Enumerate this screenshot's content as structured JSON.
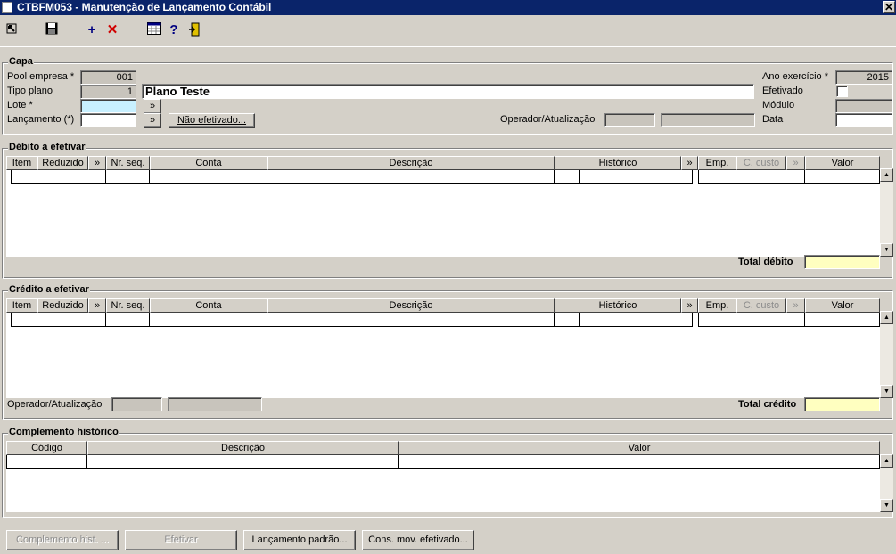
{
  "window": {
    "title": "CTBFM053 - Manutenção de Lançamento Contábil",
    "close_label": "✕"
  },
  "toolbar": {
    "exit_icon": "↖",
    "save_icon": "save-icon",
    "add": "+",
    "delete": "✕",
    "calendar_icon": "calendar-icon",
    "help": "?",
    "door_icon": "door-icon"
  },
  "capa": {
    "title": "Capa",
    "pool_label": "Pool empresa *",
    "pool_value": "001",
    "tipo_label": "Tipo plano",
    "tipo_value": "1",
    "plano_name": "Plano Teste",
    "lote_label": "Lote *",
    "lote_value": "",
    "lanc_label": "Lançamento (*)",
    "lanc_value": "",
    "lookup": "»",
    "nao_efetivado": "Não efetivado...",
    "ano_label": "Ano exercício *",
    "ano_value": "2015",
    "efetivado_label": "Efetivado",
    "modulo_label": "Módulo",
    "modulo_value": "",
    "data_label": "Data",
    "data_value": "",
    "operador_label": "Operador/Atualização"
  },
  "grid_columns": [
    "Item",
    "Reduzido",
    "»",
    "Nr. seq.",
    "Conta",
    "Descrição",
    "Histórico",
    "»",
    "Emp.",
    "C. custo",
    "»",
    "Valor"
  ],
  "debito": {
    "title": "Débito a efetivar",
    "total_label": "Total débito",
    "total_value": ""
  },
  "credito": {
    "title": "Crédito a efetivar",
    "total_label": "Total crédito",
    "total_value": "",
    "operador_label": "Operador/Atualização"
  },
  "complemento": {
    "title": "Complemento histórico",
    "columns": [
      "Código",
      "Descrição",
      "Valor"
    ]
  },
  "buttons": {
    "complemento": "Complemento hist. ...",
    "efetivar": "Efetivar",
    "padrao": "Lançamento padrão...",
    "cons": "Cons. mov. efetivado..."
  }
}
